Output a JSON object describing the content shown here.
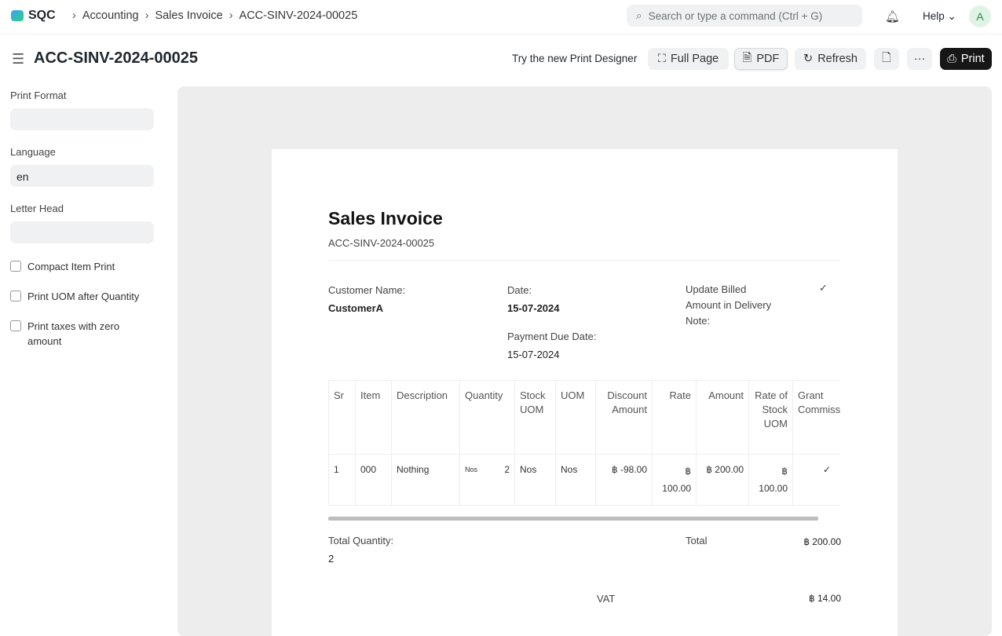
{
  "app": {
    "name": "SQC"
  },
  "breadcrumbs": [
    "Accounting",
    "Sales Invoice",
    "ACC-SINV-2024-00025"
  ],
  "search": {
    "placeholder": "Search or type a command (Ctrl + G)"
  },
  "help": "Help",
  "avatar": "A",
  "page": {
    "title": "ACC-SINV-2024-00025"
  },
  "toolbar": {
    "designer": "Try the new Print Designer",
    "full_page": "Full Page",
    "pdf": "PDF",
    "refresh": "Refresh",
    "more": "···",
    "print": "Print"
  },
  "sidebar": {
    "print_format_label": "Print Format",
    "print_format": "",
    "language_label": "Language",
    "language": "en",
    "letter_head_label": "Letter Head",
    "letter_head": "",
    "checks": [
      "Compact Item Print",
      "Print UOM after Quantity",
      "Print taxes with zero amount"
    ]
  },
  "doc": {
    "heading": "Sales Invoice",
    "name": "ACC-SINV-2024-00025",
    "customer_label": "Customer Name:",
    "customer": "CustomerA",
    "date_label": "Date:",
    "date": "15-07-2024",
    "due_label": "Payment Due Date:",
    "due": "15-07-2024",
    "billed_label": "Update Billed Amount in Delivery Note:",
    "billed": "✓",
    "columns": [
      "Sr",
      "Item",
      "Description",
      "Quantity",
      "Stock UOM",
      "UOM",
      "Discount Amount",
      "Rate",
      "Amount",
      "Rate of Stock UOM",
      "Grant Commission"
    ],
    "row": {
      "sr": "1",
      "item": "000",
      "description": "Nothing",
      "qty_uom": "Nos",
      "qty": "2",
      "stock_uom": "Nos",
      "uom": "Nos",
      "discount": "฿ -98.00",
      "rate": "฿ 100.00",
      "amount": "฿ 200.00",
      "rate_stock": "฿ 100.00",
      "grant": "✓"
    },
    "total_qty_label": "Total Quantity:",
    "total_qty": "2",
    "total_label": "Total",
    "total": "฿ 200.00",
    "vat_label": "VAT",
    "vat": "฿ 14.00"
  }
}
